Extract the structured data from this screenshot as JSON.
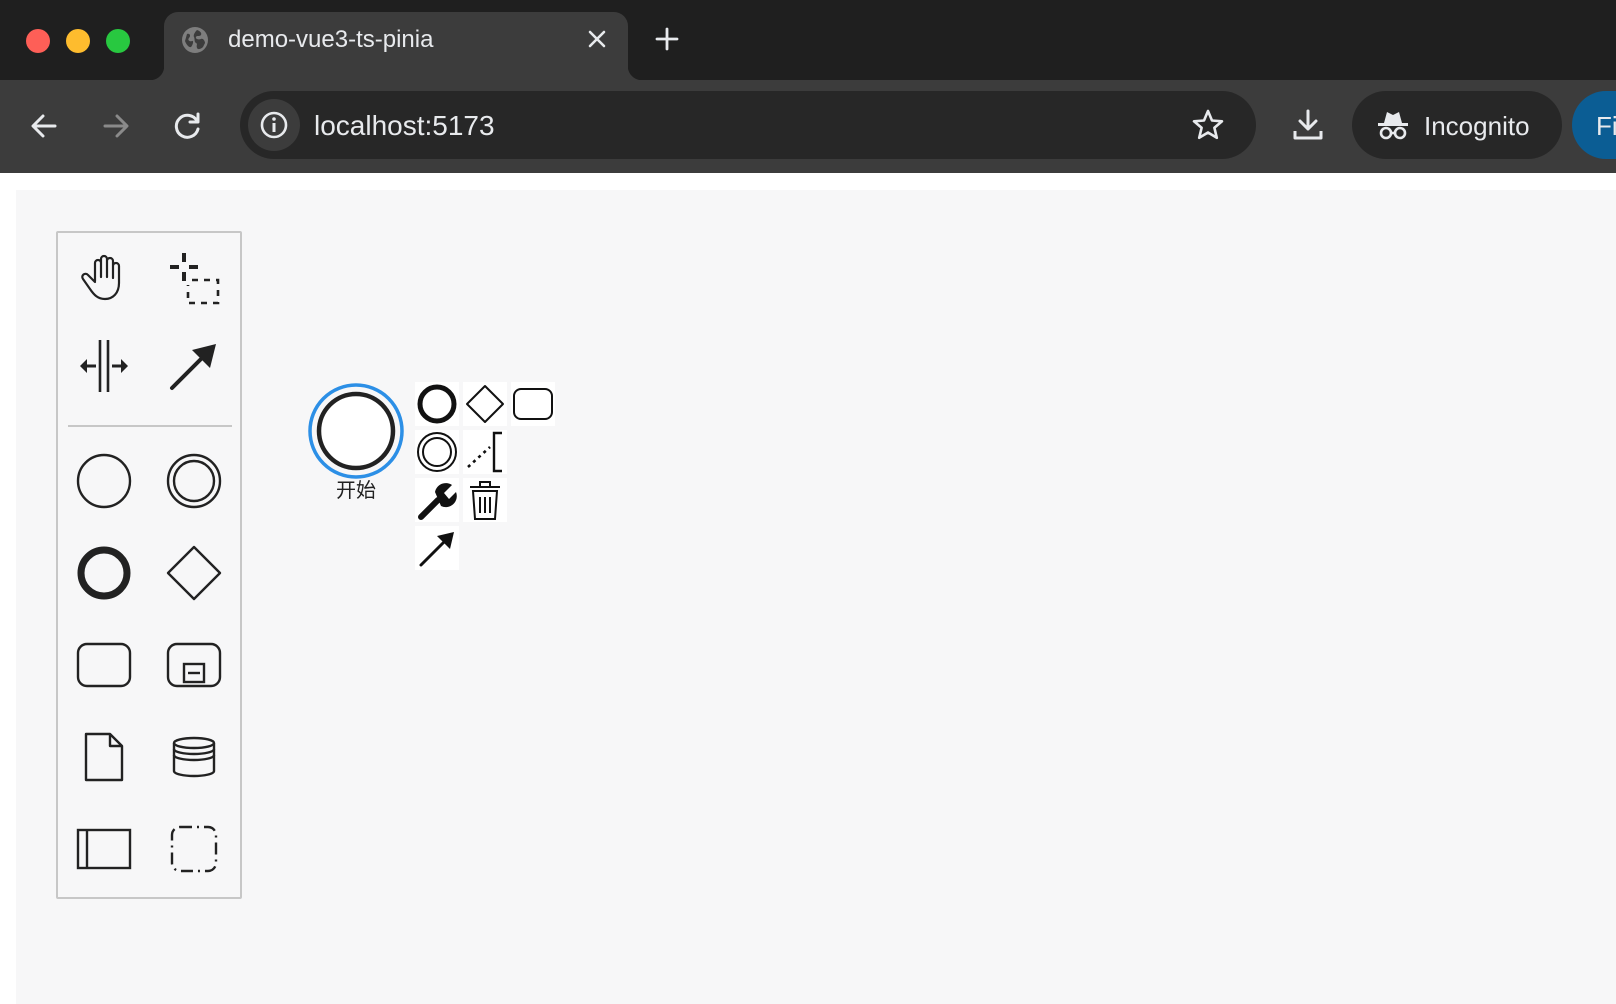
{
  "browser": {
    "tab": {
      "title": "demo-vue3-ts-pinia",
      "icon": "globe-icon"
    },
    "address": {
      "url": "localhost:5173"
    },
    "incognito_label": "Incognito",
    "profile_label": "Fi",
    "colors": {
      "close": "#fe5f57",
      "minimize": "#febc2e",
      "maximize": "#28c840",
      "tab_strip": "#1f1f1f",
      "toolbar": "#3c3c3c"
    }
  },
  "palette": {
    "tools": [
      "hand-tool-icon",
      "lasso-tool-icon",
      "space-tool-icon",
      "global-connect-icon"
    ],
    "shapes": [
      "start-event-icon",
      "intermediate-event-icon",
      "end-event-icon",
      "gateway-icon",
      "task-icon",
      "subprocess-icon",
      "data-object-icon",
      "data-store-icon",
      "participant-icon",
      "group-icon"
    ]
  },
  "diagram": {
    "start_event_label": "开始",
    "selection_color": "#2c8fe6"
  },
  "context_pad": {
    "entries": [
      "append-end-event-icon",
      "append-gateway-icon",
      "append-task-icon",
      "append-intermediate-event-icon",
      "append-text-annotation-icon",
      "change-type-icon",
      "delete-icon",
      "connect-icon"
    ]
  }
}
